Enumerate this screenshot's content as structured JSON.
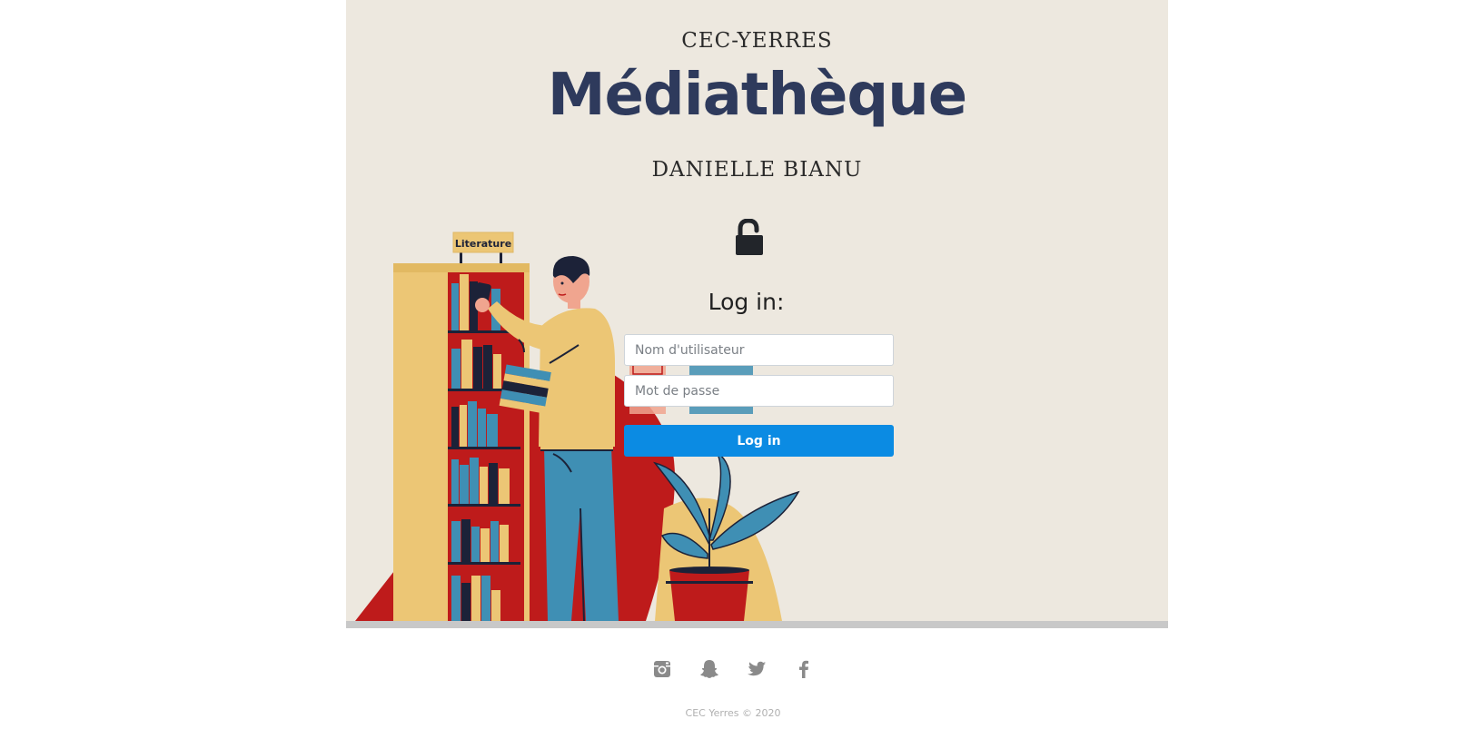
{
  "header": {
    "org_name": "CEC-YERRES",
    "title": "Médiathèque",
    "subtitle": "DANIELLE BIANU"
  },
  "illustration": {
    "shelf_sign": "Literature",
    "icon": "reading-man-bookshelf-illustration"
  },
  "login": {
    "heading": "Log in:",
    "lock_icon": "unlock-icon",
    "username_placeholder": "Nom d'utilisateur",
    "password_placeholder": "Mot de passe",
    "submit_label": "Log in"
  },
  "footer": {
    "social": [
      {
        "name": "instagram",
        "icon": "instagram-icon"
      },
      {
        "name": "snapchat",
        "icon": "snapchat-icon"
      },
      {
        "name": "twitter",
        "icon": "twitter-icon"
      },
      {
        "name": "facebook",
        "icon": "facebook-icon"
      }
    ],
    "copyright": "CEC Yerres © 2020"
  },
  "colors": {
    "hero_bg": "#ede8df",
    "brand_title": "#2e3a5c",
    "button": "#0b8be3",
    "shelf_red": "#be1b1b",
    "shelf_tan": "#ecc675",
    "book_blue": "#3f8fb4",
    "dark_navy": "#1c2238"
  }
}
